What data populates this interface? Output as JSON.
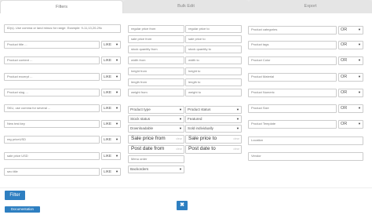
{
  "tabs": [
    "Filters",
    "Bulk Edit",
    "Export"
  ],
  "col1": {
    "ids_placeholder": "ID(s). Use comma or land minus for range. Example: 9-11,13,20-29c",
    "fields": [
      "Product title ...",
      "Product content ...",
      "Product excerpt ...",
      "Product slug ...",
      "SKU, use comma for several ...",
      "New test key",
      "reg priceUSD",
      "sale price USD",
      "seo title"
    ],
    "like": "LIKE"
  },
  "col2": {
    "left": [
      "regular price from",
      "sale price from",
      "stock quantity from",
      "width from",
      "height from",
      "length from",
      "weight from"
    ],
    "right": [
      "regular price to",
      "sale price to",
      "stock quantity to",
      "width to",
      "height to",
      "length to",
      "weight to"
    ],
    "selects_left": [
      "Product type",
      "Stock status",
      "Downloadable"
    ],
    "selects_right": [
      "Product status",
      "Featured",
      "Sold individually"
    ],
    "sale_from": "Sale price from",
    "sale_to": "Sale price to",
    "post_from": "Post date from",
    "post_to": "Post date to",
    "clear": "clear",
    "menu_order": "Menu order",
    "backorders": "Backorders"
  },
  "col3": {
    "taxonomies": [
      "Product categories",
      "Product tags",
      "Product Color",
      "Product Material",
      "Product Numeric",
      "Product Size",
      "Product Template"
    ],
    "or": "OR",
    "extra": [
      "Location",
      "Vendor"
    ]
  },
  "buttons": {
    "filter": "Filter",
    "documentation": "Documentation",
    "close": "✖"
  }
}
